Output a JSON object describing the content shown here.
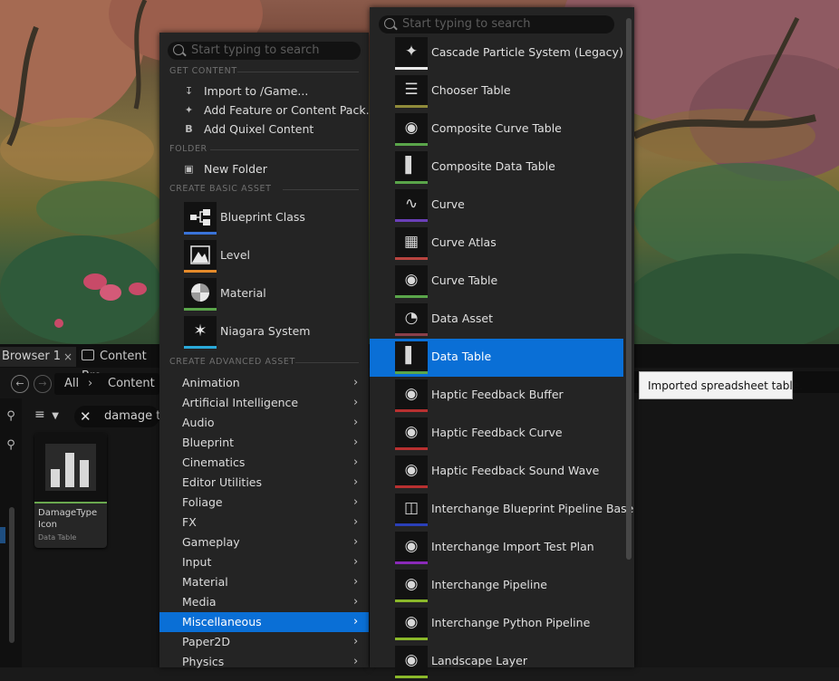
{
  "content_browser": {
    "tab1_label": "Browser 1",
    "tab1_close": "×",
    "tab2_label": "Content Bro",
    "breadcrumb_all": "All",
    "breadcrumb_sep": "›",
    "breadcrumb_content": "Content",
    "search_value": "damage ty",
    "asset": {
      "name": "DamageType Icon",
      "type": "Data Table"
    }
  },
  "menu_main": {
    "search_placeholder": "Start typing to search",
    "sections": {
      "get_content": "GET CONTENT",
      "folder": "FOLDER",
      "create_basic": "CREATE BASIC ASSET",
      "create_advanced": "CREATE ADVANCED ASSET"
    },
    "get_content_items": [
      "Import to /Game...",
      "Add Feature or Content Pack...",
      "Add Quixel Content"
    ],
    "folder_items": [
      "New Folder"
    ],
    "basic_assets": [
      {
        "label": "Blueprint Class",
        "color": "#3a73d8"
      },
      {
        "label": "Level",
        "color": "#e58a2a"
      },
      {
        "label": "Material",
        "color": "#5aa54a"
      },
      {
        "label": "Niagara System",
        "color": "#2aa8d8"
      }
    ],
    "categories": [
      "Animation",
      "Artificial Intelligence",
      "Audio",
      "Blueprint",
      "Cinematics",
      "Editor Utilities",
      "Foliage",
      "FX",
      "Gameplay",
      "Input",
      "Material",
      "Media",
      "Miscellaneous",
      "Paper2D",
      "Physics"
    ],
    "highlighted_category": "Miscellaneous"
  },
  "menu_sub": {
    "search_placeholder": "Start typing to search",
    "items": [
      {
        "label": "Cascade Particle System (Legacy)",
        "color": "#e8e8e8",
        "icon": "sparkle-icon"
      },
      {
        "label": "Chooser Table",
        "color": "#8f8a3a",
        "icon": "list-icon"
      },
      {
        "label": "Composite Curve Table",
        "color": "#5aa54a",
        "icon": "sphere-icon"
      },
      {
        "label": "Composite Data Table",
        "color": "#5aa54a",
        "icon": "bar-chart-icon"
      },
      {
        "label": "Curve",
        "color": "#6a3fb8",
        "icon": "curve-icon"
      },
      {
        "label": "Curve Atlas",
        "color": "#b8443f",
        "icon": "checker-icon"
      },
      {
        "label": "Curve Table",
        "color": "#5aa54a",
        "icon": "sphere-icon"
      },
      {
        "label": "Data Asset",
        "color": "#8a3f4a",
        "icon": "pie-icon"
      },
      {
        "label": "Data Table",
        "color": "#5aa54a",
        "icon": "bar-chart-icon"
      },
      {
        "label": "Haptic Feedback Buffer",
        "color": "#b83030",
        "icon": "sphere-icon"
      },
      {
        "label": "Haptic Feedback Curve",
        "color": "#b83030",
        "icon": "sphere-icon"
      },
      {
        "label": "Haptic Feedback Sound Wave",
        "color": "#b83030",
        "icon": "sphere-icon"
      },
      {
        "label": "Interchange Blueprint Pipeline Base",
        "color": "#2a3fb8",
        "icon": "node-icon"
      },
      {
        "label": "Interchange Import Test Plan",
        "color": "#8a2ab8",
        "icon": "sphere-icon"
      },
      {
        "label": "Interchange Pipeline",
        "color": "#8ab82a",
        "icon": "sphere-icon"
      },
      {
        "label": "Interchange Python Pipeline",
        "color": "#8ab82a",
        "icon": "sphere-icon"
      },
      {
        "label": "Landscape Layer",
        "color": "#8ab82a",
        "icon": "sphere-icon"
      }
    ],
    "highlighted_item": "Data Table"
  },
  "tooltip": "Imported spreadsheet table.",
  "accent_color": "#0a6fd6"
}
